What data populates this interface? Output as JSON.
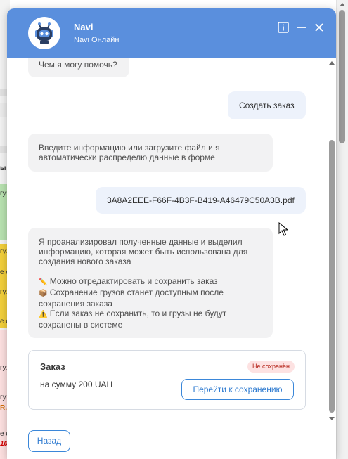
{
  "colors": {
    "header_bg": "#5a8fdd",
    "accent": "#2f7bd0",
    "badge_bg": "#fde2e2",
    "badge_text": "#b42318"
  },
  "header": {
    "title": "Navi",
    "subtitle": "Navi Онлайн",
    "icons": [
      "info-icon",
      "minimize-icon",
      "close-icon"
    ]
  },
  "messages": {
    "bot_greeting": "Чем я могу помочь?",
    "user_create": "Создать заказ",
    "bot_prompt_line1": "Введите информацию или загрузите файл и я",
    "bot_prompt_line2": "автоматически распределю данные в форме",
    "user_file": "3A8A2EEE-F66F-4B3F-B419-A46479C50A3B.pdf",
    "analysis": {
      "l1": "Я проанализировал полученные данные и выделил",
      "l2": "информацию, которая может быть использована для",
      "l3": "создания нового заказа",
      "edit_icon": "✏️",
      "edit": "Можно отредактировать и сохранить заказ",
      "cargo_icon": "📦",
      "cargo1": "Сохранение грузов станет доступным после",
      "cargo2": "сохранения заказа",
      "warn_icon": "⚠️",
      "warn1": "Если заказ не сохранить, то и грузы не будут",
      "warn2": "сохранены в системе"
    }
  },
  "order": {
    "title": "Заказ",
    "status": "Не сохранён",
    "sum": "на сумму 200 UAH",
    "save_button": "Перейти к сохранению"
  },
  "back_button": "Назад",
  "background_app": {
    "fragments": [
      "ы",
      "гу:",
      "гу:",
      "гу:",
      "гу:",
      "е с",
      "е с",
      "гу:",
      "R,",
      "е с",
      "10"
    ]
  }
}
